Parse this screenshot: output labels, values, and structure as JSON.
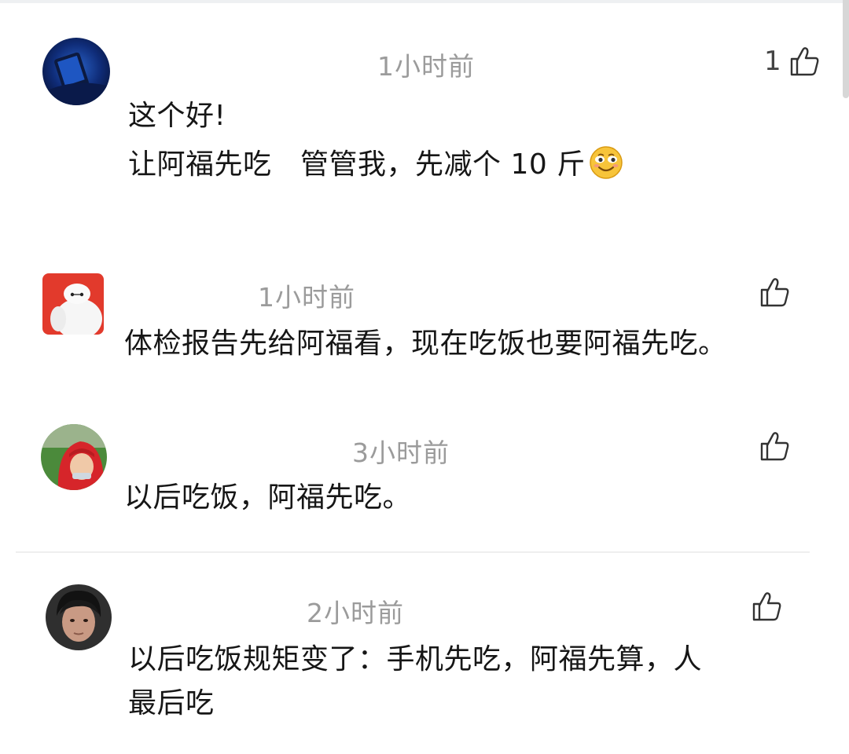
{
  "comments": [
    {
      "avatar_icon": "blue-phone-avatar",
      "time": "1小时前",
      "like_count": "1",
      "lines": [
        "这个好!",
        "让阿福先吃　管管我，先减个 10 斤"
      ],
      "emoji": "smiling-face-emoji"
    },
    {
      "avatar_icon": "baymax-avatar",
      "time": "1小时前",
      "like_count": "",
      "lines": [
        "体检报告先给阿福看，现在吃饭也要阿福先吃。"
      ]
    },
    {
      "avatar_icon": "red-hood-avatar",
      "time": "3小时前",
      "like_count": "",
      "lines": [
        "以后吃饭，阿福先吃。"
      ]
    },
    {
      "avatar_icon": "young-man-avatar",
      "time": "2小时前",
      "like_count": "",
      "lines": [
        "以后吃饭规矩变了：手机先吃，阿福先算，人",
        "最后吃"
      ]
    }
  ]
}
